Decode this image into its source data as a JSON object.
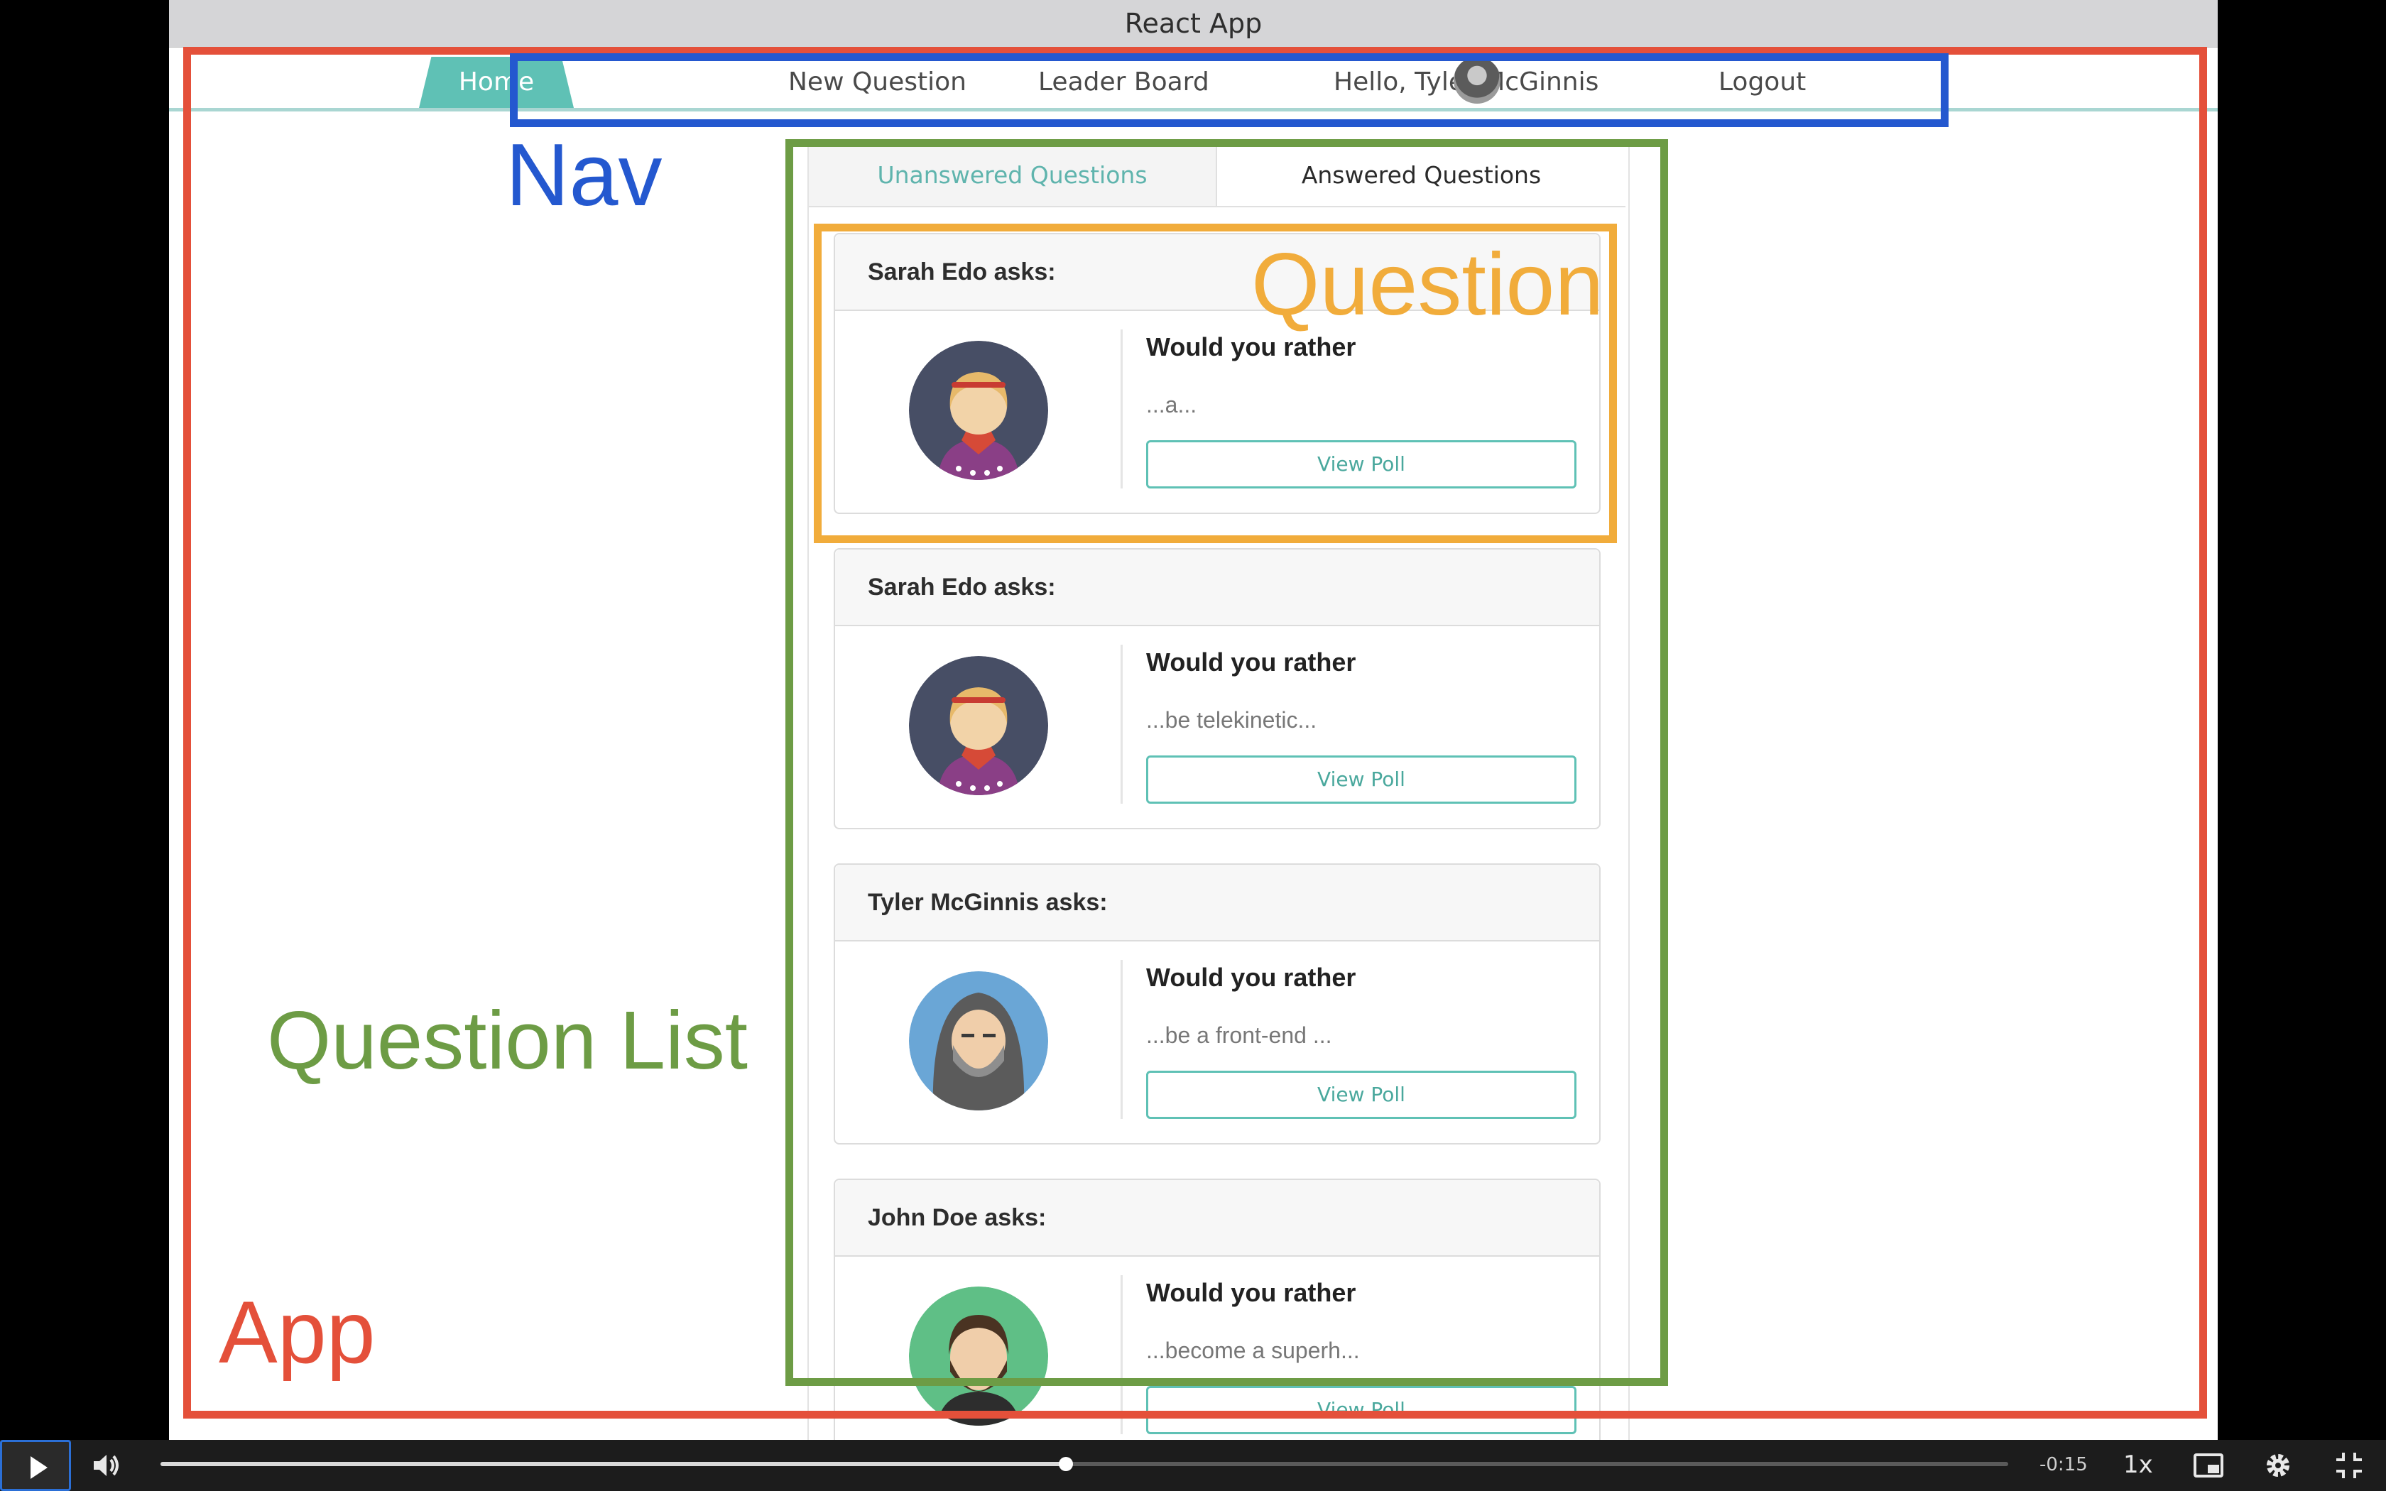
{
  "window": {
    "title": "React App"
  },
  "nav": {
    "items": [
      {
        "label": "Home",
        "active": true
      },
      {
        "label": "New Question"
      },
      {
        "label": "Leader Board"
      }
    ],
    "greeting": "Hello, Tyler McGinnis",
    "logout_label": "Logout"
  },
  "annotations": {
    "nav": "Nav",
    "question": "Question",
    "question_list": "Question List",
    "app": "App"
  },
  "tabs": {
    "unanswered": "Unanswered Questions",
    "answered": "Answered Questions",
    "active": "unanswered"
  },
  "questions": [
    {
      "asker": "Sarah Edo asks:",
      "title": "Would you rather",
      "snippet": "...a...",
      "button": "View Poll",
      "avatar": "woman-red-scarf-avatar"
    },
    {
      "asker": "Sarah Edo asks:",
      "title": "Would you rather",
      "snippet": "...be telekinetic...",
      "button": "View Poll",
      "avatar": "woman-red-scarf-avatar"
    },
    {
      "asker": "Tyler McGinnis asks:",
      "title": "Would you rather",
      "snippet": "...be a front-end ...",
      "button": "View Poll",
      "avatar": "hooded-bearded-avatar"
    },
    {
      "asker": "John Doe asks:",
      "title": "Would you rather",
      "snippet": "...become a superh...",
      "button": "View Poll",
      "avatar": "bearded-man-avatar"
    }
  ],
  "player": {
    "time_remaining": "-0:15",
    "playback_rate": "1x",
    "progress": 0.49
  },
  "colors": {
    "accent": "#5fc1b5",
    "app_box": "#e4503a",
    "nav_box": "#2458cf",
    "list_box": "#6d9c45",
    "question_box": "#f1ac3b"
  }
}
